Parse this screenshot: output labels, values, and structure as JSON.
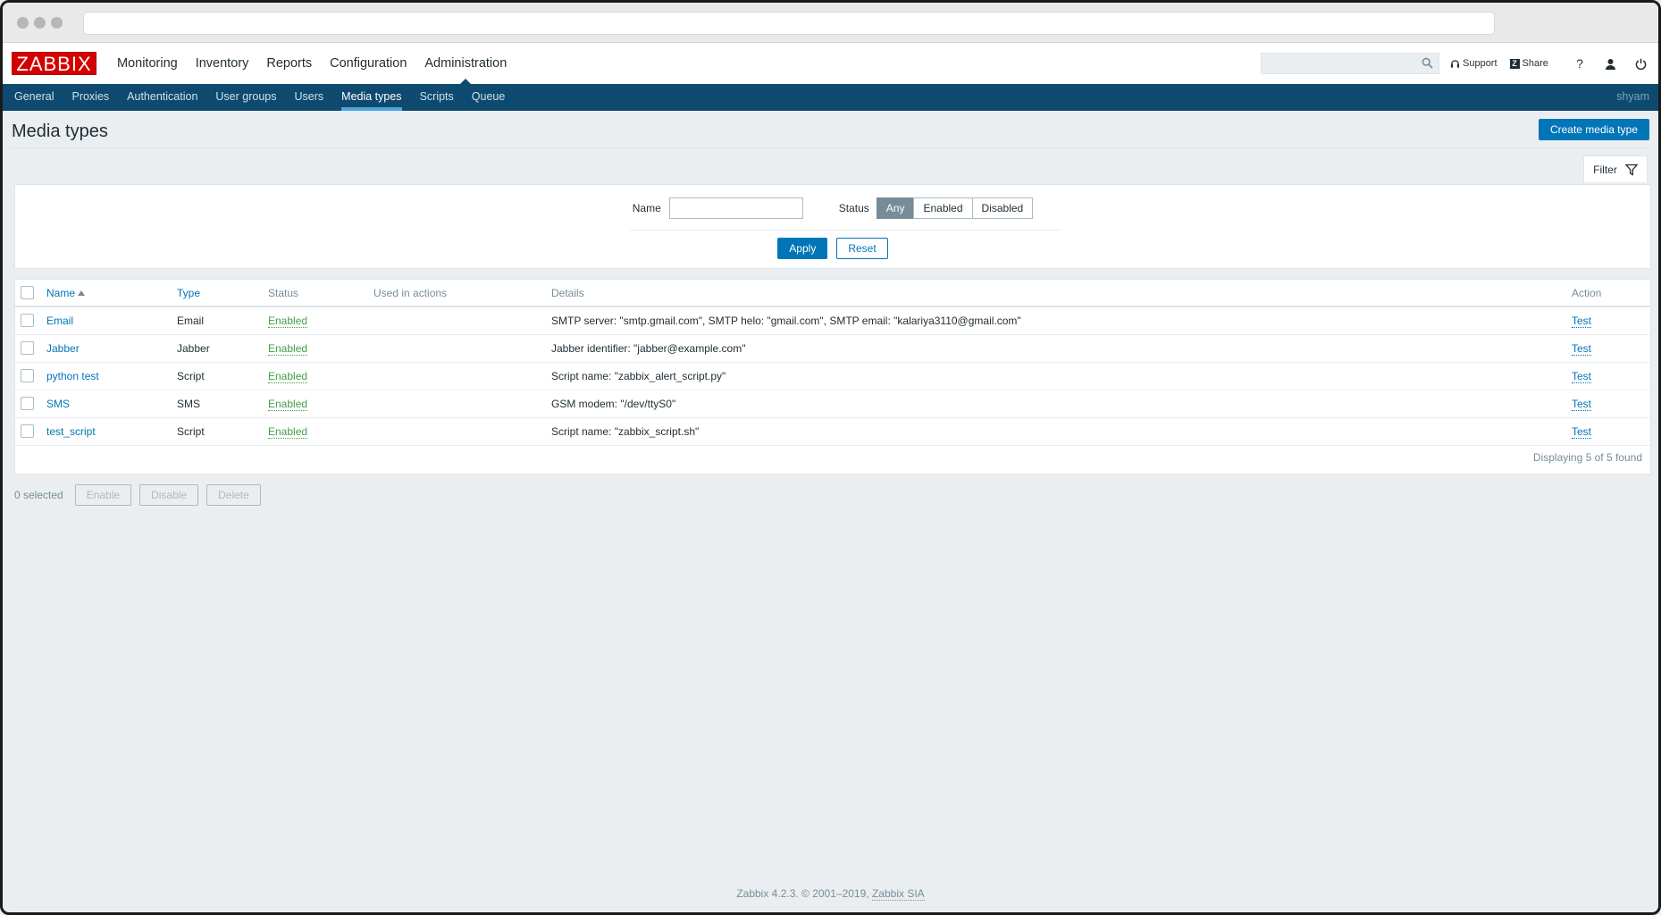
{
  "header": {
    "logo": "ZABBIX",
    "main_nav": [
      "Monitoring",
      "Inventory",
      "Reports",
      "Configuration",
      "Administration"
    ],
    "active_main": "Administration",
    "search_placeholder": "",
    "support_label": "Support",
    "share_label": "Share",
    "help_label": "?"
  },
  "subnav": {
    "items": [
      "General",
      "Proxies",
      "Authentication",
      "User groups",
      "Users",
      "Media types",
      "Scripts",
      "Queue"
    ],
    "active": "Media types",
    "user": "shyam"
  },
  "page": {
    "title": "Media types",
    "create_button": "Create media type"
  },
  "filter": {
    "tab_label": "Filter",
    "name_label": "Name",
    "name_value": "",
    "status_label": "Status",
    "status_options": [
      "Any",
      "Enabled",
      "Disabled"
    ],
    "status_selected": "Any",
    "apply_label": "Apply",
    "reset_label": "Reset"
  },
  "table": {
    "columns": [
      "Name",
      "Type",
      "Status",
      "Used in actions",
      "Details",
      "Action"
    ],
    "rows": [
      {
        "name": "Email",
        "type": "Email",
        "status": "Enabled",
        "used": "",
        "details": "SMTP server: \"smtp.gmail.com\", SMTP helo: \"gmail.com\", SMTP email: \"kalariya3110@gmail.com\"",
        "action": "Test"
      },
      {
        "name": "Jabber",
        "type": "Jabber",
        "status": "Enabled",
        "used": "",
        "details": "Jabber identifier: \"jabber@example.com\"",
        "action": "Test"
      },
      {
        "name": "python test",
        "type": "Script",
        "status": "Enabled",
        "used": "",
        "details": "Script name: \"zabbix_alert_script.py\"",
        "action": "Test"
      },
      {
        "name": "SMS",
        "type": "SMS",
        "status": "Enabled",
        "used": "",
        "details": "GSM modem: \"/dev/ttyS0\"",
        "action": "Test"
      },
      {
        "name": "test_script",
        "type": "Script",
        "status": "Enabled",
        "used": "",
        "details": "Script name: \"zabbix_script.sh\"",
        "action": "Test"
      }
    ],
    "footer": "Displaying 5 of 5 found"
  },
  "mass_actions": {
    "selected": "0 selected",
    "enable": "Enable",
    "disable": "Disable",
    "delete": "Delete"
  },
  "footer": {
    "text": "Zabbix 4.2.3. © 2001–2019,",
    "link": "Zabbix SIA"
  }
}
